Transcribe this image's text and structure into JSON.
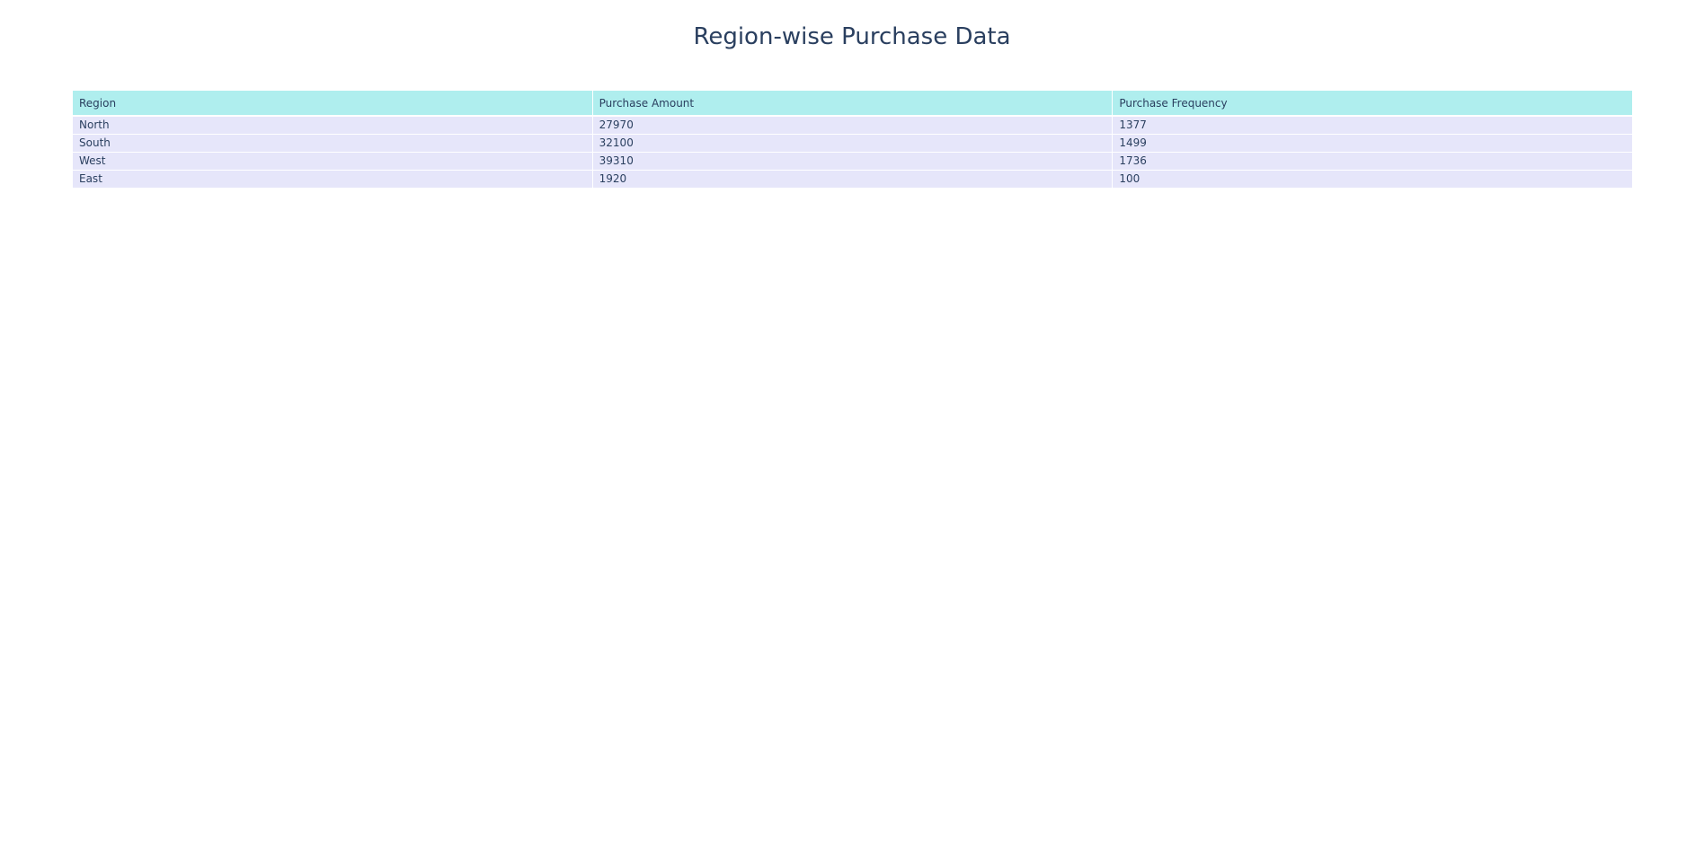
{
  "chart_data": {
    "type": "table",
    "title": "Region-wise Purchase Data",
    "header_color": "#afeeee",
    "cell_color": "#e6e6fa",
    "text_color": "#2a3f5f",
    "columns": [
      "Region",
      "Purchase Amount",
      "Purchase Frequency"
    ],
    "rows": [
      [
        "North",
        "27970",
        "1377"
      ],
      [
        "South",
        "32100",
        "1499"
      ],
      [
        "West",
        "39310",
        "1736"
      ],
      [
        "East",
        "1920",
        "100"
      ]
    ]
  }
}
